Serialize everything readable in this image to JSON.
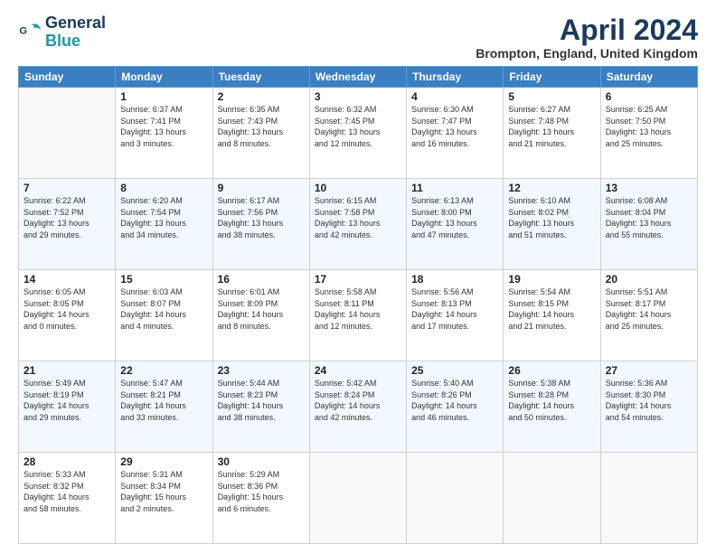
{
  "header": {
    "logo_line1": "General",
    "logo_line2": "Blue",
    "title": "April 2024",
    "subtitle": "Brompton, England, United Kingdom"
  },
  "columns": [
    "Sunday",
    "Monday",
    "Tuesday",
    "Wednesday",
    "Thursday",
    "Friday",
    "Saturday"
  ],
  "weeks": [
    [
      {
        "day": "",
        "info": ""
      },
      {
        "day": "1",
        "info": "Sunrise: 6:37 AM\nSunset: 7:41 PM\nDaylight: 13 hours\nand 3 minutes."
      },
      {
        "day": "2",
        "info": "Sunrise: 6:35 AM\nSunset: 7:43 PM\nDaylight: 13 hours\nand 8 minutes."
      },
      {
        "day": "3",
        "info": "Sunrise: 6:32 AM\nSunset: 7:45 PM\nDaylight: 13 hours\nand 12 minutes."
      },
      {
        "day": "4",
        "info": "Sunrise: 6:30 AM\nSunset: 7:47 PM\nDaylight: 13 hours\nand 16 minutes."
      },
      {
        "day": "5",
        "info": "Sunrise: 6:27 AM\nSunset: 7:48 PM\nDaylight: 13 hours\nand 21 minutes."
      },
      {
        "day": "6",
        "info": "Sunrise: 6:25 AM\nSunset: 7:50 PM\nDaylight: 13 hours\nand 25 minutes."
      }
    ],
    [
      {
        "day": "7",
        "info": "Sunrise: 6:22 AM\nSunset: 7:52 PM\nDaylight: 13 hours\nand 29 minutes."
      },
      {
        "day": "8",
        "info": "Sunrise: 6:20 AM\nSunset: 7:54 PM\nDaylight: 13 hours\nand 34 minutes."
      },
      {
        "day": "9",
        "info": "Sunrise: 6:17 AM\nSunset: 7:56 PM\nDaylight: 13 hours\nand 38 minutes."
      },
      {
        "day": "10",
        "info": "Sunrise: 6:15 AM\nSunset: 7:58 PM\nDaylight: 13 hours\nand 42 minutes."
      },
      {
        "day": "11",
        "info": "Sunrise: 6:13 AM\nSunset: 8:00 PM\nDaylight: 13 hours\nand 47 minutes."
      },
      {
        "day": "12",
        "info": "Sunrise: 6:10 AM\nSunset: 8:02 PM\nDaylight: 13 hours\nand 51 minutes."
      },
      {
        "day": "13",
        "info": "Sunrise: 6:08 AM\nSunset: 8:04 PM\nDaylight: 13 hours\nand 55 minutes."
      }
    ],
    [
      {
        "day": "14",
        "info": "Sunrise: 6:05 AM\nSunset: 8:05 PM\nDaylight: 14 hours\nand 0 minutes."
      },
      {
        "day": "15",
        "info": "Sunrise: 6:03 AM\nSunset: 8:07 PM\nDaylight: 14 hours\nand 4 minutes."
      },
      {
        "day": "16",
        "info": "Sunrise: 6:01 AM\nSunset: 8:09 PM\nDaylight: 14 hours\nand 8 minutes."
      },
      {
        "day": "17",
        "info": "Sunrise: 5:58 AM\nSunset: 8:11 PM\nDaylight: 14 hours\nand 12 minutes."
      },
      {
        "day": "18",
        "info": "Sunrise: 5:56 AM\nSunset: 8:13 PM\nDaylight: 14 hours\nand 17 minutes."
      },
      {
        "day": "19",
        "info": "Sunrise: 5:54 AM\nSunset: 8:15 PM\nDaylight: 14 hours\nand 21 minutes."
      },
      {
        "day": "20",
        "info": "Sunrise: 5:51 AM\nSunset: 8:17 PM\nDaylight: 14 hours\nand 25 minutes."
      }
    ],
    [
      {
        "day": "21",
        "info": "Sunrise: 5:49 AM\nSunset: 8:19 PM\nDaylight: 14 hours\nand 29 minutes."
      },
      {
        "day": "22",
        "info": "Sunrise: 5:47 AM\nSunset: 8:21 PM\nDaylight: 14 hours\nand 33 minutes."
      },
      {
        "day": "23",
        "info": "Sunrise: 5:44 AM\nSunset: 8:23 PM\nDaylight: 14 hours\nand 38 minutes."
      },
      {
        "day": "24",
        "info": "Sunrise: 5:42 AM\nSunset: 8:24 PM\nDaylight: 14 hours\nand 42 minutes."
      },
      {
        "day": "25",
        "info": "Sunrise: 5:40 AM\nSunset: 8:26 PM\nDaylight: 14 hours\nand 46 minutes."
      },
      {
        "day": "26",
        "info": "Sunrise: 5:38 AM\nSunset: 8:28 PM\nDaylight: 14 hours\nand 50 minutes."
      },
      {
        "day": "27",
        "info": "Sunrise: 5:36 AM\nSunset: 8:30 PM\nDaylight: 14 hours\nand 54 minutes."
      }
    ],
    [
      {
        "day": "28",
        "info": "Sunrise: 5:33 AM\nSunset: 8:32 PM\nDaylight: 14 hours\nand 58 minutes."
      },
      {
        "day": "29",
        "info": "Sunrise: 5:31 AM\nSunset: 8:34 PM\nDaylight: 15 hours\nand 2 minutes."
      },
      {
        "day": "30",
        "info": "Sunrise: 5:29 AM\nSunset: 8:36 PM\nDaylight: 15 hours\nand 6 minutes."
      },
      {
        "day": "",
        "info": ""
      },
      {
        "day": "",
        "info": ""
      },
      {
        "day": "",
        "info": ""
      },
      {
        "day": "",
        "info": ""
      }
    ]
  ]
}
